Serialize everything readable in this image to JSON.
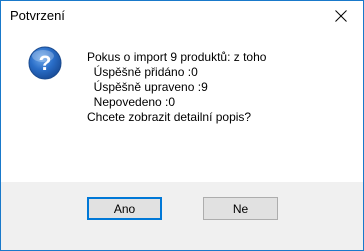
{
  "window": {
    "title": "Potvrzení"
  },
  "dialog": {
    "icon": "question-icon",
    "message_lines": [
      "Pokus o import 9 produktů: z toho",
      "  Úspěšně přidáno :0",
      "  Úspěšně upraveno :9",
      "  Nepovedeno :0",
      "Chcete zobrazit detailní popis?"
    ]
  },
  "buttons": {
    "yes_label": "Ano",
    "no_label": "Ne"
  },
  "colors": {
    "accent": "#0078d7",
    "icon_blue": "#1f5fb0"
  }
}
